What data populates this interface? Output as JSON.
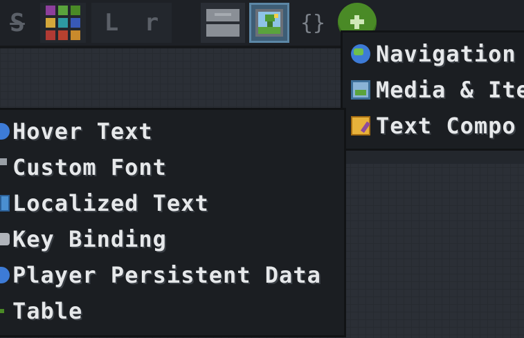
{
  "toolbar": {
    "strike_label": "S",
    "l_label": "L",
    "r_label": "r",
    "curly_label": "{}",
    "color_swatches": [
      "#8d3f9c",
      "#5aa33c",
      "#4a8a26",
      "#d4a83b",
      "#2d9aa1",
      "#3859b8",
      "#b03a34",
      "#b8412f",
      "#c98a2c"
    ]
  },
  "menu": {
    "items": [
      {
        "label": "Navigation",
        "icon": "globe-icon"
      },
      {
        "label": "Media & Ite",
        "icon": "image-icon"
      },
      {
        "label": "Text Compo",
        "icon": "note-icon"
      }
    ]
  },
  "submenu": {
    "items": [
      {
        "label": "Hover Text",
        "icon": "hover-icon"
      },
      {
        "label": "Custom Font",
        "icon": "font-icon"
      },
      {
        "label": "Localized Text",
        "icon": "localized-icon"
      },
      {
        "label": "Key Binding",
        "icon": "key-icon"
      },
      {
        "label": "Player Persistent Data",
        "icon": "data-icon"
      },
      {
        "label": "Table",
        "icon": "table-icon"
      }
    ]
  }
}
